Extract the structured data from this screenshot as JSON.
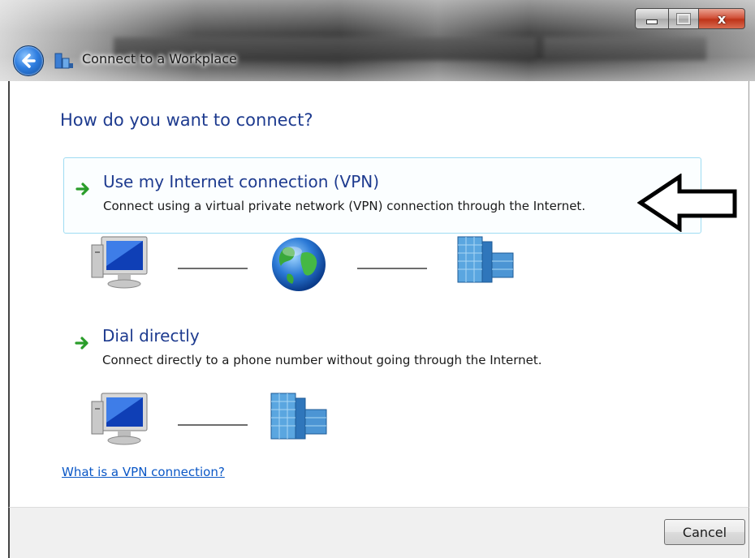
{
  "window": {
    "title": "Connect to a Workplace",
    "controls": {
      "minimize": "minimize",
      "maximize": "maximize",
      "close": "x"
    }
  },
  "main": {
    "heading": "How do you want to connect?",
    "options": [
      {
        "title": "Use my Internet connection (VPN)",
        "description": "Connect using a virtual private network (VPN) connection through the Internet.",
        "icons": [
          "computer-icon",
          "globe-icon",
          "office-building-icon"
        ],
        "selected": true
      },
      {
        "title": "Dial directly",
        "description": "Connect directly to a phone number without going through the Internet.",
        "icons": [
          "computer-icon",
          "office-building-icon"
        ],
        "selected": false
      }
    ],
    "help_link": "What is a VPN connection?"
  },
  "footer": {
    "cancel_label": "Cancel"
  },
  "colors": {
    "heading": "#1e3b8f",
    "link": "#0a57c6",
    "selected_border": "#9fdcf2",
    "arrow_green": "#2a9d2a"
  }
}
